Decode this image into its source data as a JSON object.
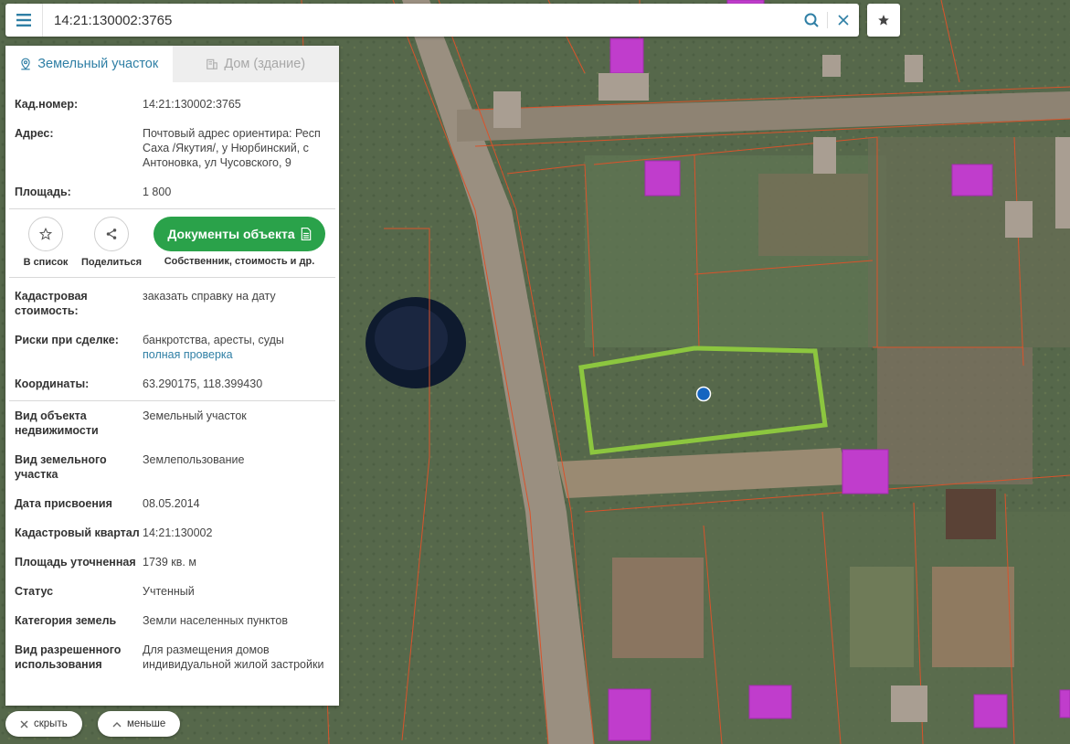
{
  "search": {
    "value": "14:21:130002:3765"
  },
  "tabs": [
    {
      "label": "Земельный участок",
      "active": true
    },
    {
      "label": "Дом (здание)",
      "active": false
    }
  ],
  "info_top": [
    {
      "label": "Кад.номер:",
      "value": "14:21:130002:3765",
      "link": true
    },
    {
      "label": "Адрес:",
      "value": "Почтовый адрес ориентира: Респ Саха /Якутия/, у Нюрбинский, с Антоновка, ул Чусовского, 9"
    },
    {
      "label": "Площадь:",
      "value": "1 800"
    }
  ],
  "actions": {
    "favorite_label": "В список",
    "share_label": "Поделиться",
    "docs_label": "Документы объекта",
    "docs_sub": "Собственник, стоимость и др."
  },
  "info_mid": {
    "cost_label": "Кадастровая стоимость:",
    "cost_link": "заказать справку на дату",
    "risks_label": "Риски при сделке:",
    "risks_value": "банкротства, аресты, суды",
    "risks_link": "полная проверка",
    "coords_label": "Координаты:",
    "coords_value": "63.290175, 118.399430"
  },
  "info_bottom": [
    {
      "label": "Вид объекта недвижимости",
      "value": "Земельный участок"
    },
    {
      "label": "Вид земельного участка",
      "value": "Землепользование"
    },
    {
      "label": "Дата присвоения",
      "value": "08.05.2014"
    },
    {
      "label": "Кадастровый квартал",
      "value": "14:21:130002"
    },
    {
      "label": "Площадь уточненная",
      "value": "1739 кв. м"
    },
    {
      "label": "Статус",
      "value": "Учтенный"
    },
    {
      "label": "Категория земель",
      "value": "Земли населенных пунктов"
    },
    {
      "label": "Вид разрешенного использования",
      "value": "Для размещения домов индивидуальной жилой застройки"
    }
  ],
  "bottom": {
    "hide_label": "скрыть",
    "less_label": "меньше"
  },
  "colors": {
    "accent": "#2f7fa5",
    "green_button": "#2aa24a",
    "parcel_outline": "#8cc63f",
    "marker": "#1565c0"
  }
}
